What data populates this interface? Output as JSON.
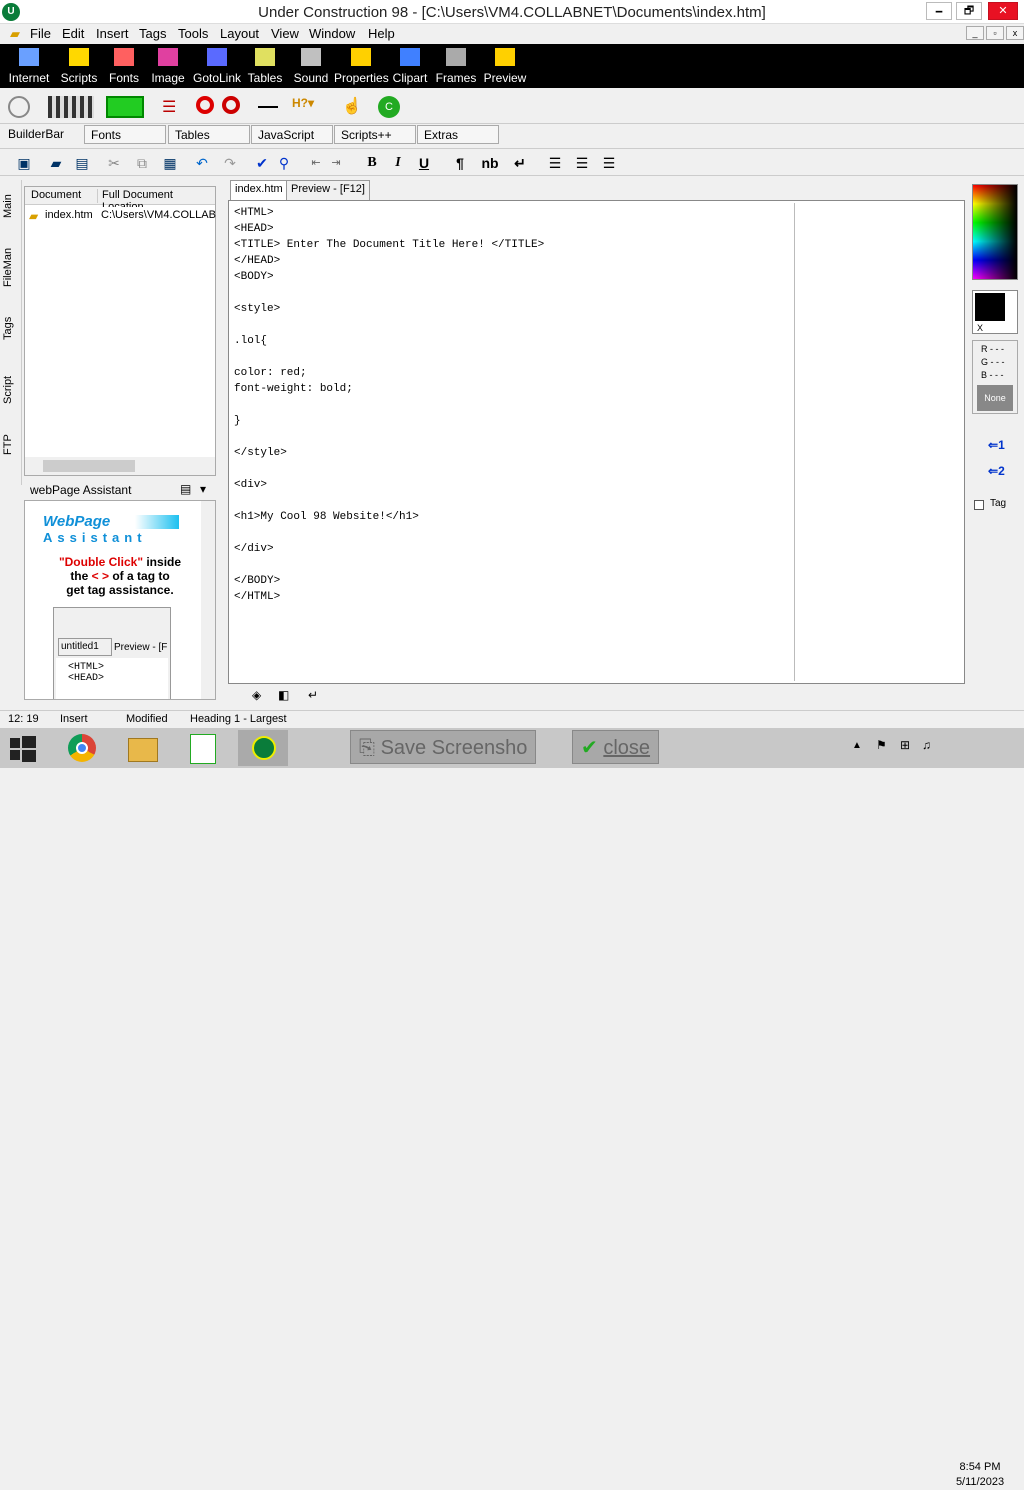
{
  "window": {
    "title": "Under Construction 98  - [C:\\Users\\VM4.COLLABNET\\Documents\\index.htm]",
    "icon": "app-logo-icon",
    "min": "🗕",
    "max": "🗗",
    "close": "✕"
  },
  "menu": [
    "File",
    "Edit",
    "Insert",
    "Tags",
    "Tools",
    "Layout",
    "View",
    "Window",
    "Help"
  ],
  "mdi": {
    "min": "_",
    "restore": "▫",
    "close": "x"
  },
  "toolbar_black": [
    {
      "label": "Internet",
      "icon": "internet-icon",
      "color": "#6aa0ff"
    },
    {
      "label": "Scripts",
      "icon": "scripts-icon",
      "color": "#ffd800"
    },
    {
      "label": "Fonts",
      "icon": "fonts-icon",
      "color": "#ff6060"
    },
    {
      "label": "Image",
      "icon": "image-icon",
      "color": "#e040a0"
    },
    {
      "label": "GotoLink",
      "icon": "gotolink-icon",
      "color": "#5a6aff"
    },
    {
      "label": "Tables",
      "icon": "tables-icon",
      "color": "#e0e060"
    },
    {
      "label": "Sound",
      "icon": "sound-icon",
      "color": "#c0c0c0"
    },
    {
      "label": "Properties",
      "icon": "properties-icon",
      "color": "#ffd000"
    },
    {
      "label": "Clipart",
      "icon": "clipart-icon",
      "color": "#4080ff"
    },
    {
      "label": "Frames",
      "icon": "frames-icon",
      "color": "#aaaaaa"
    },
    {
      "label": "Preview",
      "icon": "preview-icon",
      "color": "#ffd000"
    }
  ],
  "builder_tabs": [
    "BuilderBar",
    "Fonts",
    "Tables",
    "JavaScript",
    "Scripts++",
    "Extras"
  ],
  "format": {
    "bold": "B",
    "italic": "I",
    "underline": "U",
    "para": "¶",
    "nb": "nb",
    "enter": "↵"
  },
  "side_tabs": [
    "Main",
    "FileMan",
    "Tags",
    "Script",
    "FTP"
  ],
  "doc_panel": {
    "col1": "Document",
    "col2": "Full Document Location",
    "rows": [
      {
        "name": "index.htm",
        "path": "C:\\Users\\VM4.COLLAB"
      }
    ]
  },
  "assistant": {
    "header": "webPage Assistant",
    "title": "WebPage",
    "subtitle": "Assistant",
    "line1a": "\"Double Click\"",
    "line1b": " inside",
    "line2a": "the ",
    "line2b": "< >",
    "line2c": " of  a  tag to",
    "line3": "get tag assistance.",
    "mini_tab1": "untitled1",
    "mini_tab2": "Preview - [F",
    "mini_code": "<HTML>\n<HEAD>"
  },
  "editor_tabs": [
    "index.htm",
    "Preview - [F12]"
  ],
  "code": "<HTML>\n<HEAD>\n<TITLE> Enter The Document Title Here! </TITLE>\n</HEAD>\n<BODY>\n\n<style>\n\n.lol{\n\ncolor: red;\nfont-weight: bold;\n\n}\n\n</style>\n\n<div>\n\n<h1>My Cool 98 Website!</h1>\n\n</div>\n\n</BODY>\n</HTML>",
  "right": {
    "r": "R - - -",
    "g": "G - - -",
    "b": "B - - -",
    "none": "None",
    "x": "X",
    "h1": "1",
    "h2": "2",
    "tag": "Tag"
  },
  "status": {
    "pos": "12: 19",
    "mode": "Insert",
    "modified": "Modified",
    "hint": "Heading 1 - Largest"
  },
  "taskbar": {
    "screenshot": "Save Screensho",
    "close": "close",
    "time": "8:54 PM",
    "date": "5/11/2023"
  }
}
